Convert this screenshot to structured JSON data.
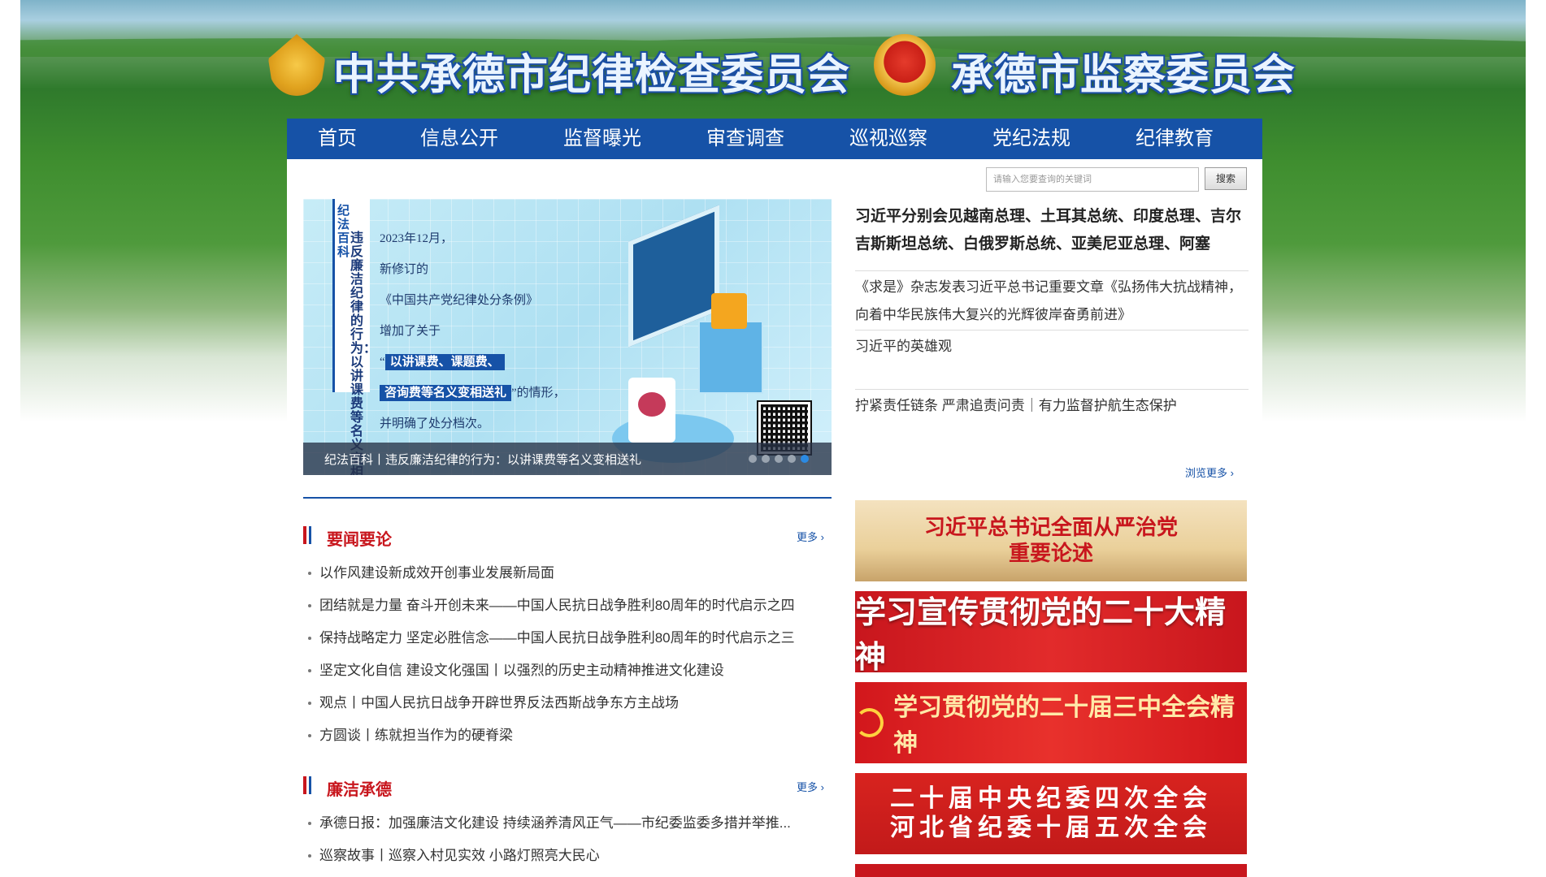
{
  "header": {
    "title_left": "中共承德市纪律检查委员会",
    "title_right": "承德市监察委员会"
  },
  "nav": {
    "items": [
      "首页",
      "信息公开",
      "监督曝光",
      "审查调查",
      "巡视巡察",
      "党纪法规",
      "纪律教育"
    ]
  },
  "search": {
    "placeholder": "请输入您要查询的关键词",
    "button": "搜索"
  },
  "carousel": {
    "tag": "纪法百科",
    "vertical_text": "违反廉洁纪律的行为：以讲课费等名义变相送礼",
    "lines": [
      "2023年12月，",
      "新修订的",
      "《中国共产党纪律处分条例》",
      "增加了关于"
    ],
    "highlight_1": "以讲课费、课题费、",
    "highlight_2": "咨询费等名义变相送礼",
    "line_after_highlight": "”的情形，",
    "line_last": "并明确了处分档次。",
    "caption": "纪法百科丨违反廉洁纪律的行为：以讲课费等名义变相送礼",
    "slide_count": 5,
    "active_slide": 5
  },
  "headlines": {
    "top": "习近平分别会见越南总理、土耳其总统、印度总理、吉尔吉斯斯坦总统、白俄罗斯总统、亚美尼亚总理、阿塞",
    "items": [
      "《求是》杂志发表习近平总书记重要文章《弘扬伟大抗战精神，向着中华民族伟大复兴的光辉彼岸奋勇前进》",
      "习近平的英雄观",
      "拧紧责任链条 严肃追责问责｜有力监督护航生态保护"
    ],
    "more": "浏览更多"
  },
  "section_news": {
    "title": "要闻要论",
    "more": "更多",
    "items": [
      "以作风建设新成效开创事业发展新局面",
      "团结就是力量 奋斗开创未来——中国人民抗日战争胜利80周年的时代启示之四",
      "保持战略定力 坚定必胜信念——中国人民抗日战争胜利80周年的时代启示之三",
      "坚定文化自信 建设文化强国丨以强烈的历史主动精神推进文化建设",
      "观点丨中国人民抗日战争开辟世界反法西斯战争东方主战场",
      "方圆谈丨练就担当作为的硬脊梁"
    ]
  },
  "section_clean": {
    "title": "廉洁承德",
    "more": "更多",
    "items": [
      "承德日报：加强廉洁文化建设 持续涵养清风正气——市纪委监委多措并举推...",
      "巡察故事丨巡察入村见实效 小路灯照亮大民心"
    ]
  },
  "promos": {
    "p1_line1": "习近平总书记全面从严治党",
    "p1_line2": "重要论述",
    "p2": "学习宣传贯彻党的二十大精神",
    "p3": "学习贯彻党的二十届三中全会精神",
    "p4_line1": "二十届中央纪委四次全会",
    "p4_line2": "河北省纪委十届五次全会"
  },
  "colors": {
    "nav_blue": "#1652a7",
    "accent_red": "#c8161d"
  }
}
